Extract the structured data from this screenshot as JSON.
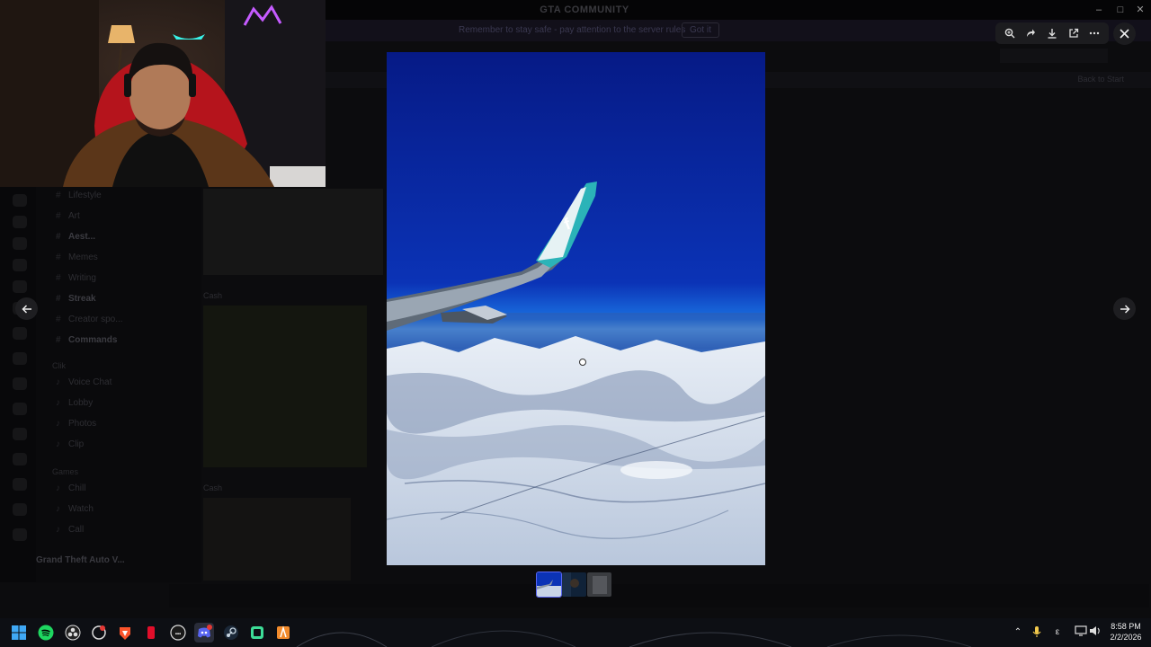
{
  "window": {
    "title": "GTA COMMUNITY",
    "notice": "Remember to stay safe - pay attention to the server rules",
    "notice_button": "Got it",
    "jump_to_present": "Back to Start"
  },
  "channels": [
    {
      "name": "Lifestyle",
      "bold": false
    },
    {
      "name": "Art",
      "bold": false
    },
    {
      "name": "Aest...",
      "bold": true
    },
    {
      "name": "Memes",
      "bold": false
    },
    {
      "name": "Writing",
      "bold": false
    },
    {
      "name": "Streak",
      "bold": true
    },
    {
      "name": "Creator spo...",
      "bold": false
    },
    {
      "name": "Commands",
      "bold": true
    }
  ],
  "channel_category_1": "Clik",
  "channels_b": [
    "Voice Chat",
    "Lobby",
    "Photos",
    "Clip"
  ],
  "channel_category_2": "Games",
  "channels_c": [
    "Chill",
    "Watch",
    "Call"
  ],
  "activity": "Grand Theft Auto V...",
  "chat": {
    "author_1": "Cash",
    "author_2": "Cash"
  },
  "viewer": {
    "toolbar": [
      {
        "icon": "zoom-icon"
      },
      {
        "icon": "forward-icon"
      },
      {
        "icon": "download-icon"
      },
      {
        "icon": "open-external-icon"
      },
      {
        "icon": "more-icon"
      }
    ],
    "thumbnail_count": 3,
    "selected_thumbnail": 0
  },
  "taskbar": {
    "time": "8:58 PM",
    "date": "2/2/2026",
    "apps": [
      "windows-start",
      "spotify",
      "obs",
      "chrome",
      "brave",
      "app-red",
      "app-steam-like",
      "discord",
      "steam",
      "app-green",
      "app-orange"
    ]
  },
  "colors": {
    "sky_top": "#0b2aa8",
    "sky_horizon": "#1565d8",
    "wing_teal": "#2bb3b8",
    "discord_blurple": "#5865f2"
  }
}
